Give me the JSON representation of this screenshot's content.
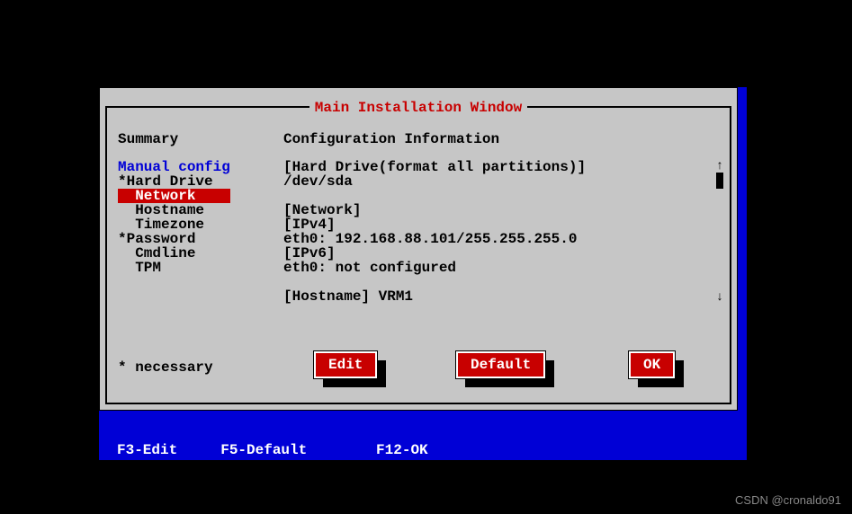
{
  "window": {
    "title": "Main Installation Window",
    "header_summary": "Summary",
    "header_config": "Configuration Information"
  },
  "menu": {
    "items": [
      {
        "label": "Manual config",
        "style": "blue"
      },
      {
        "label": "*Hard Drive"
      },
      {
        "label": "  Network",
        "style": "sel"
      },
      {
        "label": "  Hostname"
      },
      {
        "label": "  Timezone"
      },
      {
        "label": "*Password"
      },
      {
        "label": "  Cmdline"
      },
      {
        "label": "  TPM"
      }
    ]
  },
  "config": {
    "lines": [
      "[Hard Drive(format all partitions)]",
      "/dev/sda",
      "",
      "[Network]",
      "[IPv4]",
      "eth0: 192.168.88.101/255.255.255.0",
      "[IPv6]",
      "eth0: not configured",
      "",
      "[Hostname] VRM1"
    ]
  },
  "scroll": {
    "up": "↑",
    "down": "↓"
  },
  "buttons": {
    "edit": "Edit",
    "default": "Default",
    "ok": "OK"
  },
  "footer": {
    "necessary": "* necessary",
    "fkeys": "F3-Edit     F5-Default        F12-OK"
  },
  "watermark": "CSDN @cronaldo91"
}
